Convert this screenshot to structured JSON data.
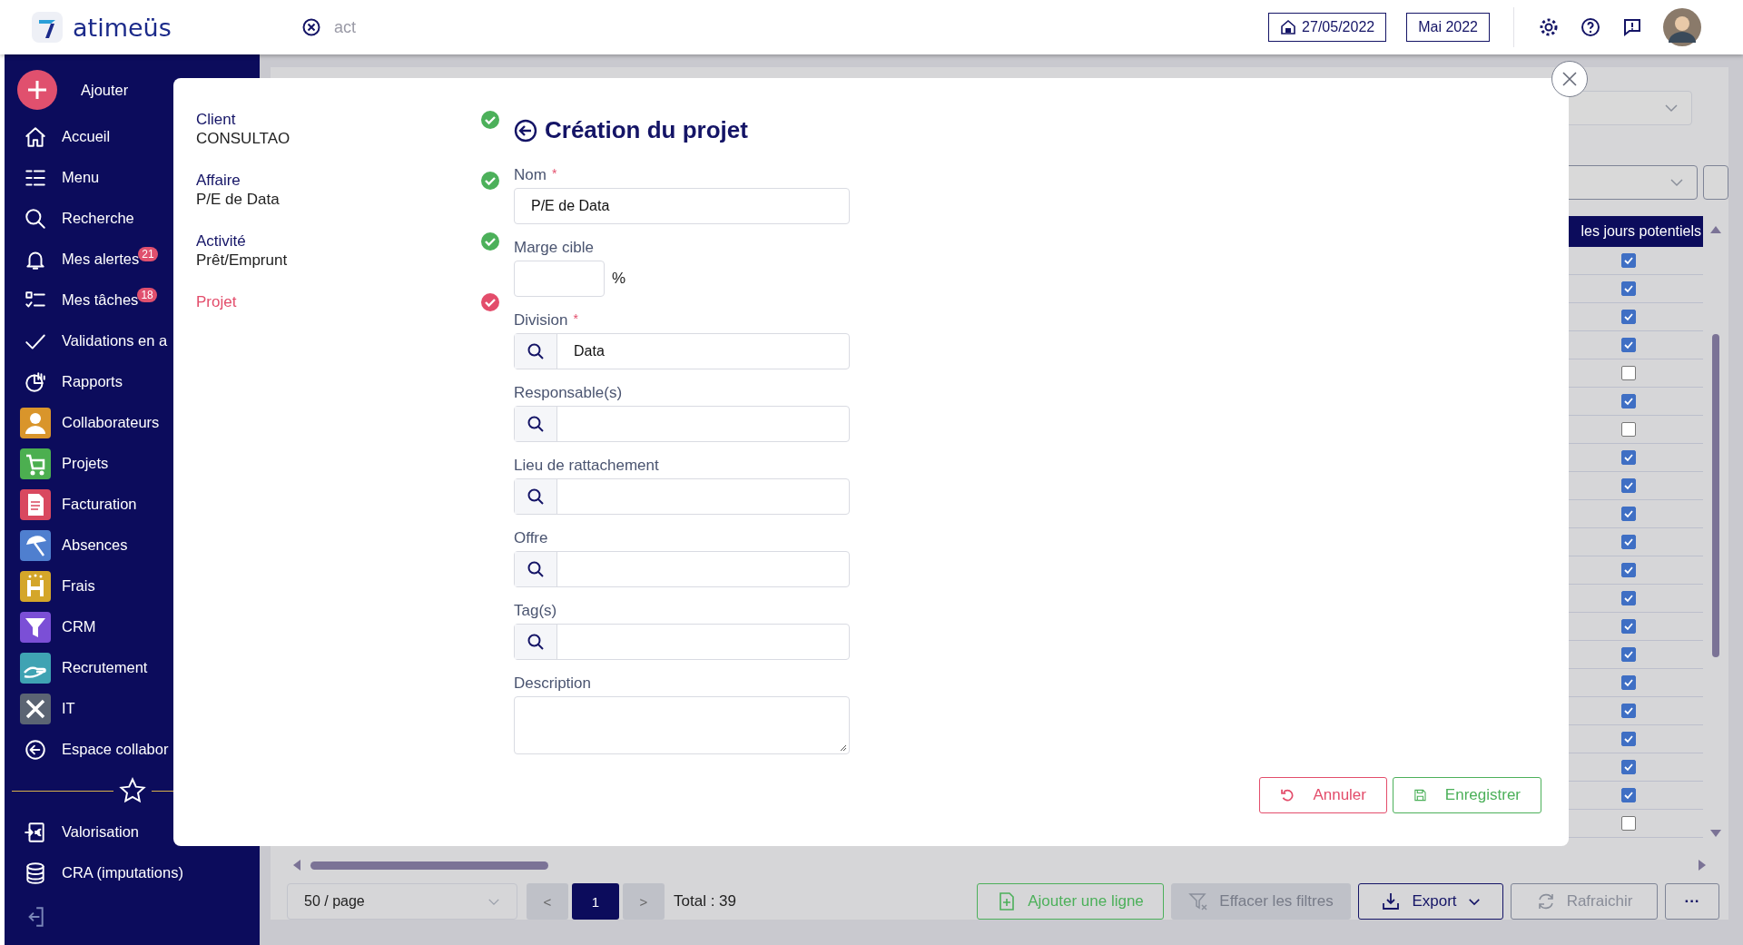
{
  "topbar": {
    "brand": "atimeüs",
    "search_value": "act",
    "date": "27/05/2022",
    "month": "Mai 2022"
  },
  "sidebar": {
    "add_label": "Ajouter",
    "items": [
      {
        "label": "Accueil",
        "kind": "plain"
      },
      {
        "label": "Menu",
        "kind": "plain"
      },
      {
        "label": "Recherche",
        "kind": "plain"
      },
      {
        "label": "Mes alertes",
        "kind": "plain",
        "badge": "21"
      },
      {
        "label": "Mes tâches",
        "kind": "plain",
        "badge": "18"
      },
      {
        "label": "Validations en a",
        "kind": "plain"
      },
      {
        "label": "Rapports",
        "kind": "plain"
      },
      {
        "label": "Collaborateurs",
        "kind": "app",
        "color": "#d9952b"
      },
      {
        "label": "Projets",
        "kind": "app",
        "color": "#4caf50"
      },
      {
        "label": "Facturation",
        "kind": "app",
        "color": "#d9485f"
      },
      {
        "label": "Absences",
        "kind": "app",
        "color": "#4f7fcf"
      },
      {
        "label": "Frais",
        "kind": "app",
        "color": "#d4a62a"
      },
      {
        "label": "CRM",
        "kind": "app",
        "color": "#7b4fd6"
      },
      {
        "label": "Recrutement",
        "kind": "app",
        "color": "#3fa3b3"
      },
      {
        "label": "IT",
        "kind": "app",
        "color": "#5b6473"
      },
      {
        "label": "Espace collabor",
        "kind": "plain"
      }
    ],
    "bottom_items": [
      {
        "label": "Valorisation"
      },
      {
        "label": "CRA (imputations)"
      }
    ]
  },
  "modal": {
    "steps": [
      {
        "title": "Client",
        "value": "CONSULTAO",
        "current": false
      },
      {
        "title": "Affaire",
        "value": "P/E de Data",
        "current": false
      },
      {
        "title": "Activité",
        "value": "Prêt/Emprunt",
        "current": false
      },
      {
        "title": "Projet",
        "current": true
      }
    ],
    "title": "Création du projet",
    "fields": [
      {
        "label": "Nom",
        "required_mark": "*",
        "kind": "text",
        "value": "P/E de Data"
      },
      {
        "label": "Marge cible",
        "kind": "percent",
        "suffix": "%"
      },
      {
        "label": "Division",
        "required_mark": "*",
        "kind": "lookup",
        "value": "Data"
      },
      {
        "label": "Responsable(s)",
        "kind": "lookup"
      },
      {
        "label": "Lieu de rattachement",
        "kind": "lookup"
      },
      {
        "label": "Offre",
        "kind": "lookup"
      },
      {
        "label": "Tag(s)",
        "kind": "lookup"
      },
      {
        "label": "Description",
        "kind": "textarea"
      }
    ],
    "buttons": [
      {
        "label": "Annuler",
        "kind": "cancel"
      },
      {
        "label": "Enregistrer",
        "kind": "save"
      }
    ]
  },
  "table": {
    "column_header": "les jours potentiels",
    "rows": [
      {
        "checked": true
      },
      {
        "checked": true
      },
      {
        "checked": true
      },
      {
        "checked": true
      },
      {
        "checked": false
      },
      {
        "checked": true
      },
      {
        "checked": false
      },
      {
        "checked": true
      },
      {
        "checked": true
      },
      {
        "checked": true
      },
      {
        "checked": true
      },
      {
        "checked": true
      },
      {
        "checked": true
      },
      {
        "checked": true
      },
      {
        "checked": true
      },
      {
        "checked": true
      },
      {
        "checked": true
      },
      {
        "checked": true
      },
      {
        "checked": true
      },
      {
        "checked": true
      },
      {
        "checked": false
      }
    ]
  },
  "pagination": {
    "page_size": "50 / page",
    "prev": "<",
    "page": "1",
    "next": ">",
    "total": "Total : 39"
  },
  "actions": [
    {
      "label": "Ajouter une ligne",
      "kind": "add"
    },
    {
      "label": "Effacer les filtres",
      "kind": "clear"
    },
    {
      "label": "Export",
      "kind": "export"
    },
    {
      "label": "Rafraichir",
      "kind": "refresh"
    },
    {
      "label": "···",
      "kind": "more"
    }
  ]
}
